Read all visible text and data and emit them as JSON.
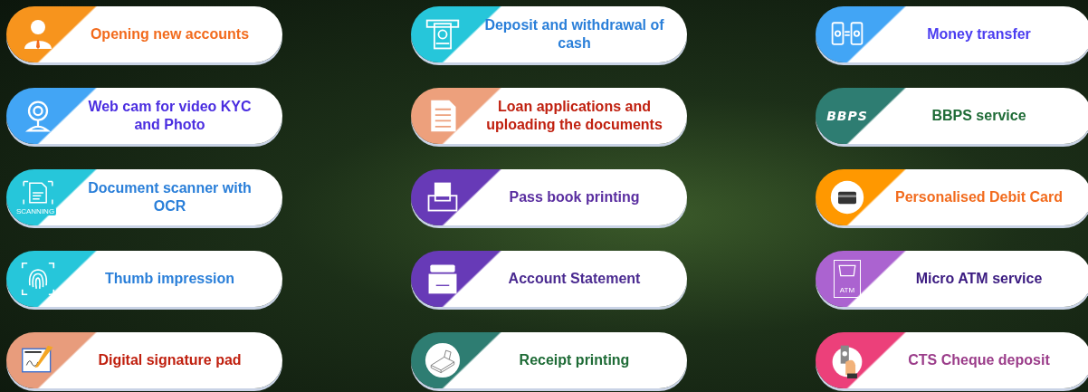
{
  "services": [
    {
      "label": "Opening new accounts",
      "kind": "person",
      "color": "#f7941d"
    },
    {
      "label": "Deposit and withdrawal of cash",
      "kind": "cash",
      "color": "#26c6da"
    },
    {
      "label": "Money transfer",
      "kind": "phones",
      "color": "#42a5f5"
    },
    {
      "label": "Web cam for video KYC and Photo",
      "kind": "webcam",
      "color": "#42a5f5"
    },
    {
      "label": "Loan applications and uploading the documents",
      "kind": "document",
      "color": "#eda07c"
    },
    {
      "label": "BBPS service",
      "kind": "logo",
      "icon_text": "BBPS",
      "color": "#2e7d72"
    },
    {
      "label": "Document scanner with OCR",
      "kind": "scanner",
      "icon_text": "SCANNING",
      "color": "#26c6da"
    },
    {
      "label": "Pass book printing",
      "kind": "printer",
      "color": "#673ab7"
    },
    {
      "label": "Personalised Debit Card",
      "kind": "card",
      "color": "#ff9800"
    },
    {
      "label": "Thumb impression",
      "kind": "fingerprint",
      "color": "#26c6da"
    },
    {
      "label": "Account Statement",
      "kind": "box",
      "color": "#673ab7"
    },
    {
      "label": "Micro ATM service",
      "kind": "atm",
      "icon_text": "ATM",
      "color": "#ab63d0"
    },
    {
      "label": "Digital signature pad",
      "kind": "signature",
      "color": "#e89c7c"
    },
    {
      "label": "Receipt printing",
      "kind": "receipt",
      "color": "#2e7d72"
    },
    {
      "label": "CTS Cheque deposit",
      "kind": "cheque",
      "color": "#ec407a"
    }
  ]
}
